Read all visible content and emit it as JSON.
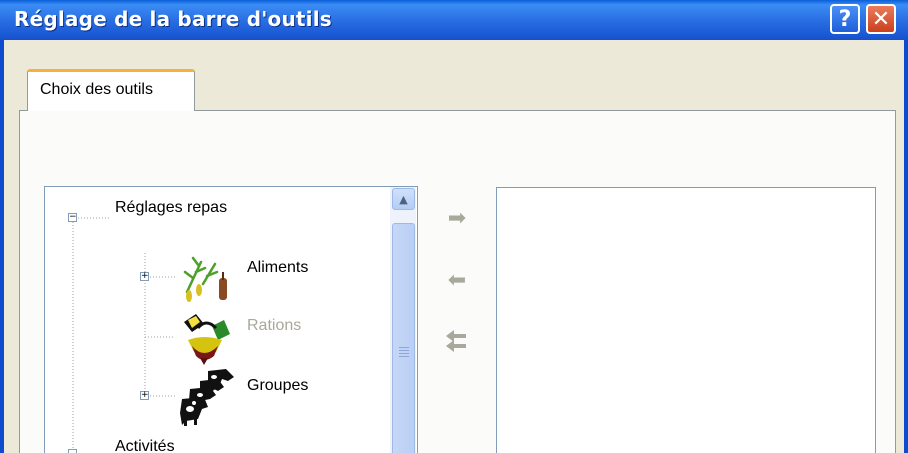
{
  "window": {
    "title": "Réglage de la barre d'outils",
    "help_label": "?",
    "close_label": "✕"
  },
  "tabs": [
    {
      "label": "Choix des outils",
      "selected": true
    }
  ],
  "tree": {
    "nodes": [
      {
        "label": "Réglages repas",
        "expanded": true,
        "icon": "none"
      },
      {
        "label": "Aliments",
        "expander": "+",
        "icon": "feed-plant-icon"
      },
      {
        "label": "Rations",
        "disabled": true,
        "icon": "ration-mixer-icon"
      },
      {
        "label": "Groupes",
        "expander": "+",
        "icon": "cattle-herd-icon"
      },
      {
        "label": "Activités",
        "icon": "none"
      }
    ]
  },
  "transfer_buttons": {
    "add_icon": "arrow-right-icon",
    "remove_icon": "arrow-left-icon",
    "remove_all_icon": "double-arrow-left-icon"
  },
  "colors": {
    "titlebar": "#2a6fe4",
    "tab_accent": "#f7b03d",
    "disabled_text": "#aca899"
  }
}
